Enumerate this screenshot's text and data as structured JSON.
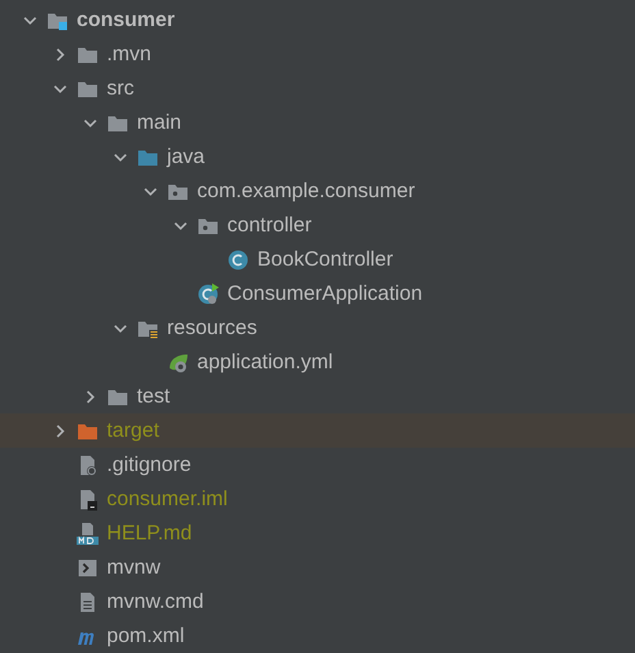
{
  "tree": [
    {
      "label": "consumer",
      "kind": "module",
      "expanded": true,
      "ignored": false,
      "children": [
        {
          "label": ".mvn",
          "kind": "folder",
          "expanded": false,
          "ignored": false
        },
        {
          "label": "src",
          "kind": "folder",
          "expanded": true,
          "ignored": false,
          "children": [
            {
              "label": "main",
              "kind": "folder",
              "expanded": true,
              "ignored": false,
              "children": [
                {
                  "label": "java",
                  "kind": "source-folder",
                  "expanded": true,
                  "ignored": false,
                  "children": [
                    {
                      "label": "com.example.consumer",
                      "kind": "package",
                      "expanded": true,
                      "ignored": false,
                      "children": [
                        {
                          "label": "controller",
                          "kind": "package",
                          "expanded": true,
                          "ignored": false,
                          "children": [
                            {
                              "label": "BookController",
                              "kind": "class",
                              "ignored": false
                            }
                          ]
                        },
                        {
                          "label": "ConsumerApplication",
                          "kind": "boot-class",
                          "ignored": false
                        }
                      ]
                    }
                  ]
                },
                {
                  "label": "resources",
                  "kind": "resources-folder",
                  "expanded": true,
                  "ignored": false,
                  "children": [
                    {
                      "label": "application.yml",
                      "kind": "spring-config",
                      "ignored": false
                    }
                  ]
                }
              ]
            },
            {
              "label": "test",
              "kind": "folder",
              "expanded": false,
              "ignored": false
            }
          ]
        },
        {
          "label": "target",
          "kind": "excluded-folder",
          "expanded": false,
          "ignored": true
        },
        {
          "label": ".gitignore",
          "kind": "ignore-file",
          "ignored": false
        },
        {
          "label": "consumer.iml",
          "kind": "module-file",
          "ignored": true
        },
        {
          "label": "HELP.md",
          "kind": "markdown",
          "ignored": true
        },
        {
          "label": "mvnw",
          "kind": "shell",
          "ignored": false
        },
        {
          "label": "mvnw.cmd",
          "kind": "text-file",
          "ignored": false
        },
        {
          "label": "pom.xml",
          "kind": "maven",
          "ignored": false
        }
      ]
    }
  ]
}
